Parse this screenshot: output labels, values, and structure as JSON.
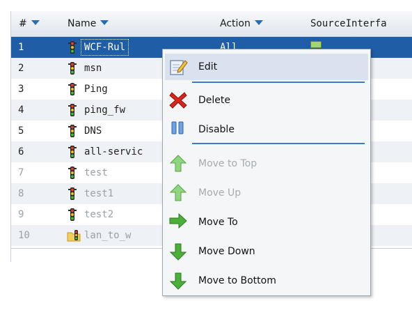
{
  "header": {
    "num": "#",
    "name": "Name",
    "action": "Action",
    "source": "SourceInterfa"
  },
  "rows": [
    {
      "num": "1",
      "name": "WCF-Rul",
      "action": "All",
      "selected": true,
      "dim": false,
      "icon": "traffic-light-icon"
    },
    {
      "num": "2",
      "name": "msn",
      "selected": false,
      "dim": false,
      "icon": "traffic-light-icon"
    },
    {
      "num": "3",
      "name": "Ping",
      "selected": false,
      "dim": false,
      "icon": "traffic-light-icon"
    },
    {
      "num": "4",
      "name": "ping_fw",
      "selected": false,
      "dim": false,
      "icon": "traffic-light-icon"
    },
    {
      "num": "5",
      "name": "DNS",
      "selected": false,
      "dim": false,
      "icon": "traffic-light-icon"
    },
    {
      "num": "6",
      "name": "all-servic",
      "selected": false,
      "dim": false,
      "icon": "traffic-light-icon"
    },
    {
      "num": "7",
      "name": "test",
      "selected": false,
      "dim": true,
      "icon": "traffic-light-icon"
    },
    {
      "num": "8",
      "name": "test1",
      "selected": false,
      "dim": true,
      "icon": "traffic-light-icon"
    },
    {
      "num": "9",
      "name": "test2",
      "selected": false,
      "dim": true,
      "icon": "traffic-light-icon"
    },
    {
      "num": "10",
      "name": "lan_to_w",
      "selected": false,
      "dim": true,
      "icon": "folder-traffic-light-icon"
    }
  ],
  "menu": {
    "items": [
      {
        "label": "Edit",
        "icon": "edit-icon",
        "disabled": false,
        "hover": true
      },
      {
        "label": "Delete",
        "icon": "delete-icon",
        "disabled": false
      },
      {
        "label": "Disable",
        "icon": "pause-icon",
        "disabled": false
      },
      {
        "label": "Move to Top",
        "icon": "arrow-up-icon",
        "disabled": true
      },
      {
        "label": "Move Up",
        "icon": "arrow-up-icon",
        "disabled": true
      },
      {
        "label": "Move To",
        "icon": "arrow-right-icon",
        "disabled": false
      },
      {
        "label": "Move Down",
        "icon": "arrow-down-icon",
        "disabled": false
      },
      {
        "label": "Move to Bottom",
        "icon": "arrow-down-icon",
        "disabled": false
      }
    ]
  },
  "colors": {
    "selected_row": "#1f5ea6",
    "accent": "#3f79c2",
    "arrow_green": "#4caf3a",
    "delete_red": "#d9261c"
  }
}
